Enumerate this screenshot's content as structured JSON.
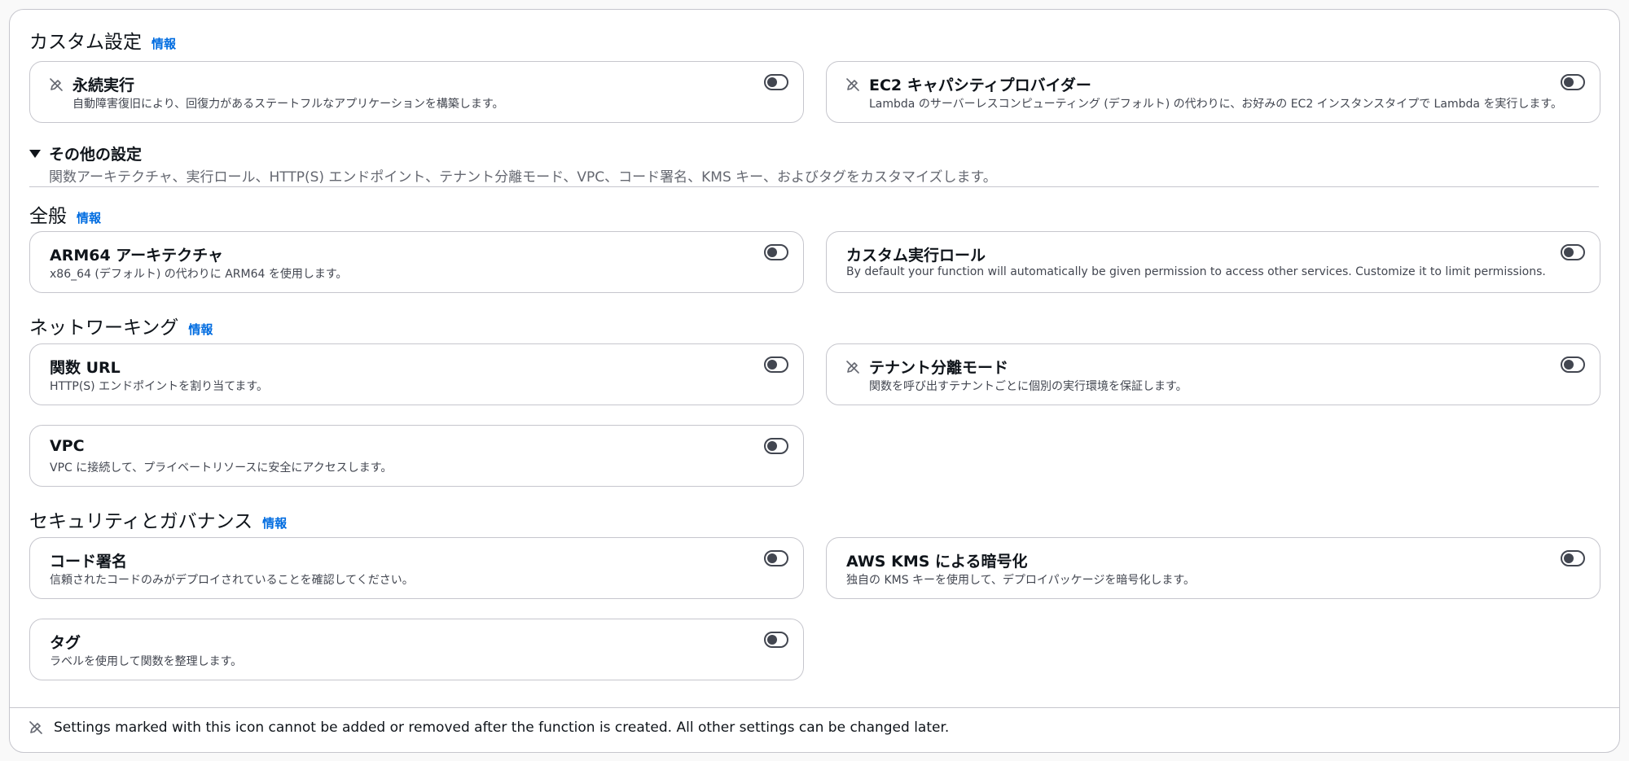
{
  "info_link": "情報",
  "custom_settings": {
    "title": "カスタム設定",
    "cards": [
      {
        "title": "永続実行",
        "desc": "自動障害復旧により、回復力があるステートフルなアプリケーションを構築します。",
        "locked": true,
        "enabled": false
      },
      {
        "title": "EC2 キャパシティプロバイダー",
        "desc": "Lambda のサーバーレスコンピューティング (デフォルト) の代わりに、お好みの EC2 インスタンスタイプで Lambda を実行します。",
        "locked": true,
        "enabled": false
      }
    ]
  },
  "other_settings": {
    "label": "その他の設定",
    "expanded": true,
    "desc": "関数アーキテクチャ、実行ロール、HTTP(S) エンドポイント、テナント分離モード、VPC、コード署名、KMS キー、およびタグをカスタマイズします。"
  },
  "general": {
    "title": "全般",
    "cards": [
      {
        "title": "ARM64 アーキテクチャ",
        "desc": "x86_64 (デフォルト) の代わりに ARM64 を使用します。",
        "locked": false,
        "enabled": false
      },
      {
        "title": "カスタム実行ロール",
        "desc": "By default your function will automatically be given permission to access other services. Customize it to limit permissions.",
        "locked": false,
        "enabled": false
      }
    ]
  },
  "networking": {
    "title": "ネットワーキング",
    "cards": [
      {
        "title": "関数 URL",
        "desc": "HTTP(S) エンドポイントを割り当てます。",
        "locked": false,
        "enabled": false
      },
      {
        "title": "テナント分離モード",
        "desc": "関数を呼び出すテナントごとに個別の実行環境を保証します。",
        "locked": true,
        "enabled": false
      },
      {
        "title": "VPC",
        "desc": "VPC に接続して、プライベートリソースに安全にアクセスします。",
        "locked": false,
        "enabled": false
      }
    ]
  },
  "security": {
    "title": "セキュリティとガバナンス",
    "cards": [
      {
        "title": "コード署名",
        "desc": "信頼されたコードのみがデプロイされていることを確認してください。",
        "locked": false,
        "enabled": false
      },
      {
        "title": "AWS KMS による暗号化",
        "desc": "独自の KMS キーを使用して、デプロイパッケージを暗号化します。",
        "locked": false,
        "enabled": false
      },
      {
        "title": "タグ",
        "desc": "ラベルを使用して関数を整理します。",
        "locked": false,
        "enabled": false
      }
    ]
  },
  "footer": {
    "text": "Settings marked with this icon cannot be added or removed after the function is created. All other settings can be changed later."
  },
  "icons": {
    "lock_icon": "pencil-slash-icon",
    "toggle_icon": "toggle-off-icon",
    "expand_icon": "caret-down-icon"
  }
}
